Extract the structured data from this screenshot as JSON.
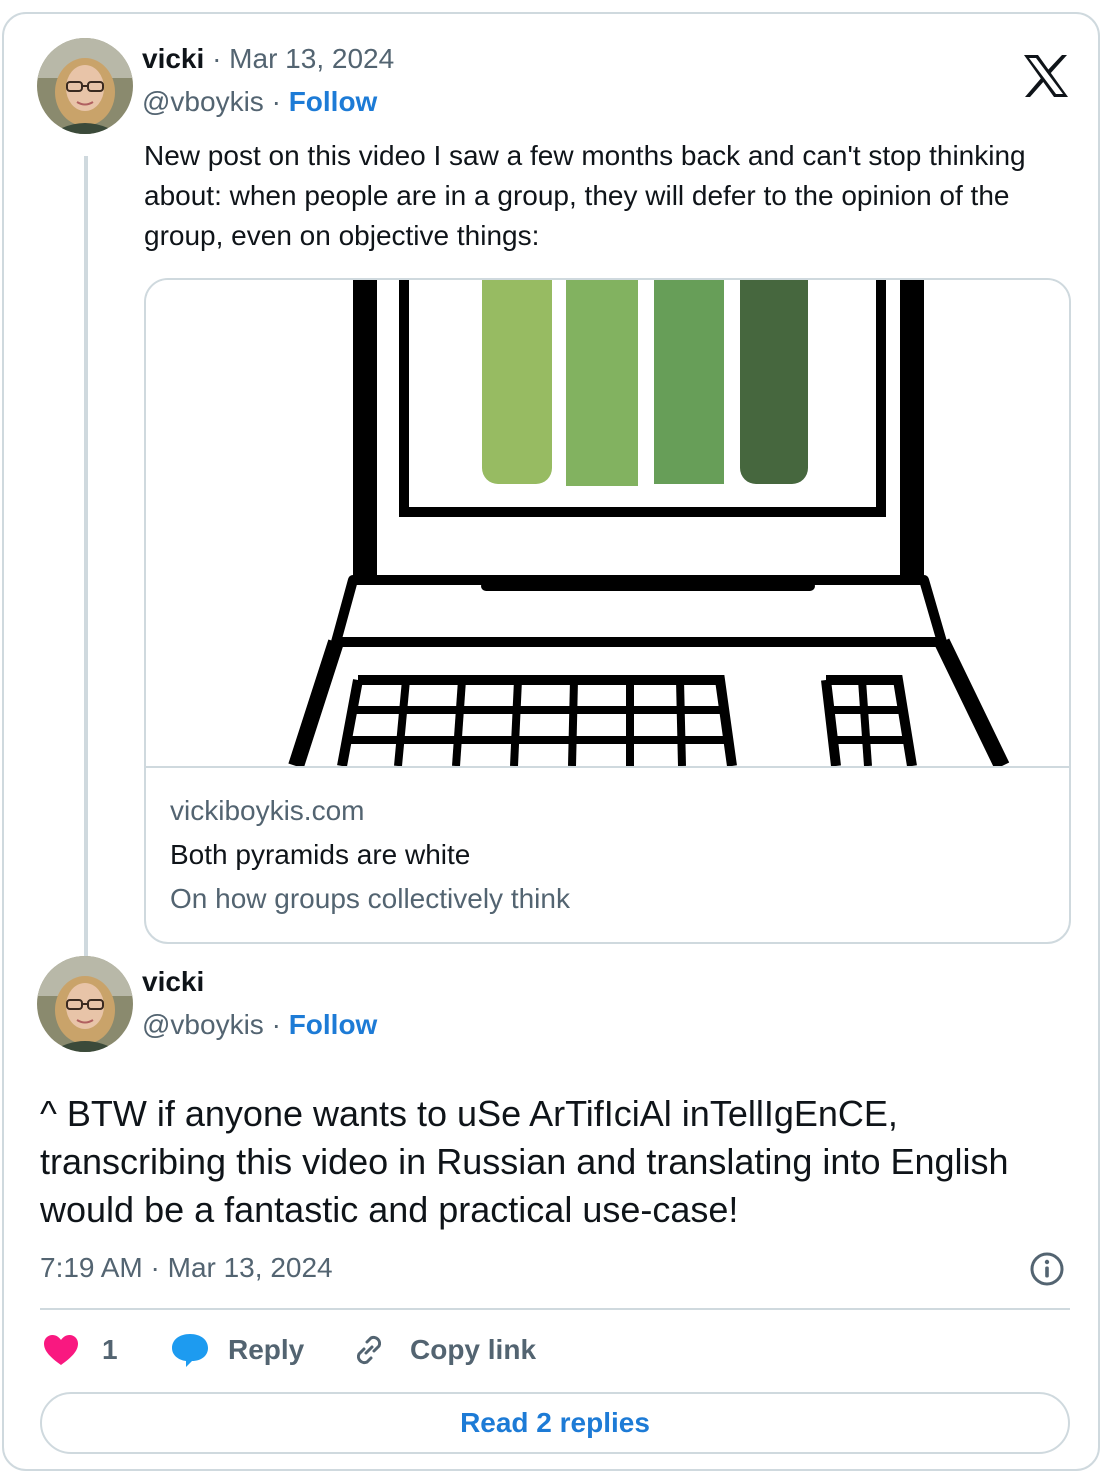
{
  "first_post": {
    "author_name": "vicki",
    "date": "Mar 13, 2024",
    "separator": "·",
    "handle": "@vboykis",
    "follow_label": "Follow",
    "text": "New post on this video I saw a few months back and can't stop thinking about: when people are in a group, they will defer to the opinion of the group, even on objective things:",
    "link_card": {
      "domain": "vickiboykis.com",
      "title": "Both pyramids are white",
      "description": "On how groups collectively think",
      "bar_colors": [
        "#97bb62",
        "#82b260",
        "#679e58",
        "#46673e"
      ]
    }
  },
  "second_post": {
    "author_name": "vicki",
    "handle": "@vboykis",
    "separator": "·",
    "follow_label": "Follow",
    "text": "^ BTW if anyone wants to uSe ArTifIciAl inTellIgEnCE, transcribing this video in Russian and translating into English would be a fantastic and practical use-case!",
    "timestamp": "7:19 AM · Mar 13, 2024"
  },
  "actions": {
    "like_count": "1",
    "reply_label": "Reply",
    "copy_link_label": "Copy link"
  },
  "read_replies_label": "Read 2 replies",
  "colors": {
    "accent": "#1d7bd6",
    "like": "#f91880",
    "muted": "#536471",
    "border": "#cfd9de"
  },
  "icons": [
    "x-logo-icon",
    "heart-icon",
    "reply-bubble-icon",
    "link-icon",
    "info-icon"
  ]
}
